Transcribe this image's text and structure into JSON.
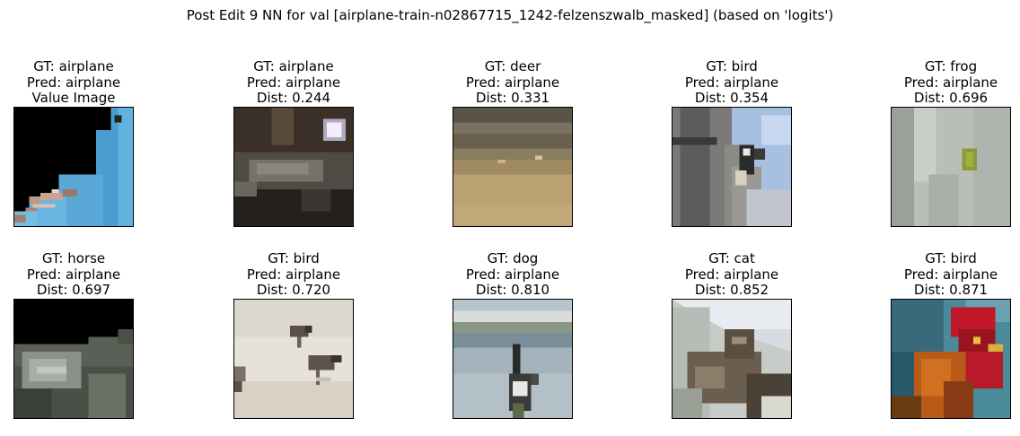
{
  "figure": {
    "title": "Post Edit 9 NN for val [airplane-train-n02867715_1242-felzenszwalb_masked] (based on 'logits')"
  },
  "panels": [
    {
      "gt": "GT: airplane",
      "pred": "Pred: airplane",
      "extra": "Value Image",
      "image": "masked-airplane-thumbnail"
    },
    {
      "gt": "GT: airplane",
      "pred": "Pred: airplane",
      "extra": "Dist: 0.244",
      "image": "night-street-thumbnail"
    },
    {
      "gt": "GT: deer",
      "pred": "Pred: airplane",
      "extra": "Dist: 0.331",
      "image": "field-deer-thumbnail"
    },
    {
      "gt": "GT: bird",
      "pred": "Pred: airplane",
      "extra": "Dist: 0.354",
      "image": "woodpecker-tree-thumbnail"
    },
    {
      "gt": "GT: frog",
      "pred": "Pred: airplane",
      "extra": "Dist: 0.696",
      "image": "green-frog-thumbnail"
    },
    {
      "gt": "GT: horse",
      "pred": "Pred: airplane",
      "extra": "Dist: 0.697",
      "image": "masked-horse-thumbnail"
    },
    {
      "gt": "GT: bird",
      "pred": "Pred: airplane",
      "extra": "Dist: 0.720",
      "image": "sandpipers-beach-thumbnail"
    },
    {
      "gt": "GT: dog",
      "pred": "Pred: airplane",
      "extra": "Dist: 0.810",
      "image": "dog-water-thumbnail"
    },
    {
      "gt": "GT: cat",
      "pred": "Pred: airplane",
      "extra": "Dist: 0.852",
      "image": "cat-house-thumbnail"
    },
    {
      "gt": "GT: bird",
      "pred": "Pred: airplane",
      "extra": "Dist: 0.871",
      "image": "rooster-thumbnail"
    }
  ]
}
